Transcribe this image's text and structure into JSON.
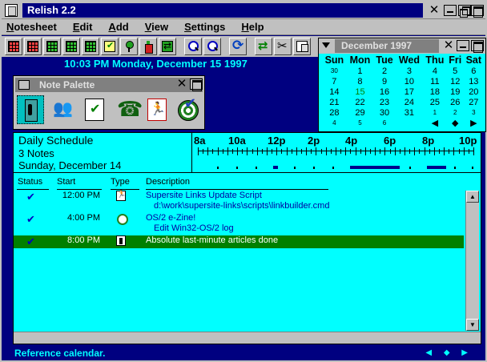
{
  "window": {
    "title": "Relish 2.2"
  },
  "menu": [
    "Notesheet",
    "Edit",
    "Add",
    "View",
    "Settings",
    "Help"
  ],
  "toolbar": {
    "icons": [
      "grid-view-icon",
      "red-grid-icon",
      "grid-week-icon",
      "green-grid-icon",
      "grid-month-icon",
      "note-check-icon",
      "pushpin-icon",
      "bottle-icon",
      "swap-icon",
      "zoom-out-icon",
      "zoom-in-icon",
      "refresh-icon",
      "transfer-icon",
      "scissors-icon",
      "paste-icon"
    ]
  },
  "clock": "10:03 PM Monday, December 15 1997",
  "palette": {
    "title": "Note Palette",
    "icons": [
      "door-exit-icon",
      "people-meeting-icon",
      "checklist-icon",
      "phone-icon",
      "runner-icon",
      "target-check-icon"
    ]
  },
  "calendar": {
    "title": "December 1997",
    "weekdays": [
      "Sun",
      "Mon",
      "Tue",
      "Wed",
      "Thu",
      "Fri",
      "Sat"
    ],
    "weeks": [
      [
        "30",
        "1",
        "2",
        "3",
        "4",
        "5",
        "6"
      ],
      [
        "7",
        "8",
        "9",
        "10",
        "11",
        "12",
        "13"
      ],
      [
        "14",
        "15",
        "16",
        "17",
        "18",
        "19",
        "20"
      ],
      [
        "21",
        "22",
        "23",
        "24",
        "25",
        "26",
        "27"
      ],
      [
        "28",
        "29",
        "30",
        "31",
        "1",
        "2",
        "3"
      ],
      [
        "4",
        "5",
        "6",
        "",
        "",
        "",
        ""
      ]
    ],
    "today": "15",
    "nav": [
      "◀",
      "◆",
      "▶"
    ]
  },
  "schedule": {
    "title": "Daily Schedule",
    "notes_count": "3 Notes",
    "date": "Sunday, December 14",
    "timeline_labels": [
      "8a",
      "10a",
      "12p",
      "2p",
      "4p",
      "6p",
      "8p",
      "10p"
    ],
    "columns": {
      "status": "Status",
      "start": "Start",
      "type": "Type",
      "description": "Description"
    },
    "rows": [
      {
        "status": "✔",
        "start": "12:00 PM",
        "type": "runner-icon",
        "desc": "Supersite Links Update Script",
        "sub": "d:\\work\\supersite-links\\scripts\\linkbuilder.cmd",
        "selected": false
      },
      {
        "status": "✔",
        "start": "4:00 PM",
        "type": "target-icon",
        "desc": "OS/2 e-Zine!",
        "sub": "Edit Win32-OS/2 log",
        "selected": false
      },
      {
        "status": "✔",
        "start": "8:00 PM",
        "type": "door-exit-icon",
        "desc": "Absolute last-minute articles done",
        "sub": "",
        "selected": true
      }
    ]
  },
  "statusbar": {
    "text": "Reference calendar.",
    "arrows": "◀ ◆ ▶"
  },
  "colors": {
    "background": "#000080",
    "panel": "#00ffff",
    "selected_row": "#008000",
    "chrome": "#c0c0c0"
  }
}
